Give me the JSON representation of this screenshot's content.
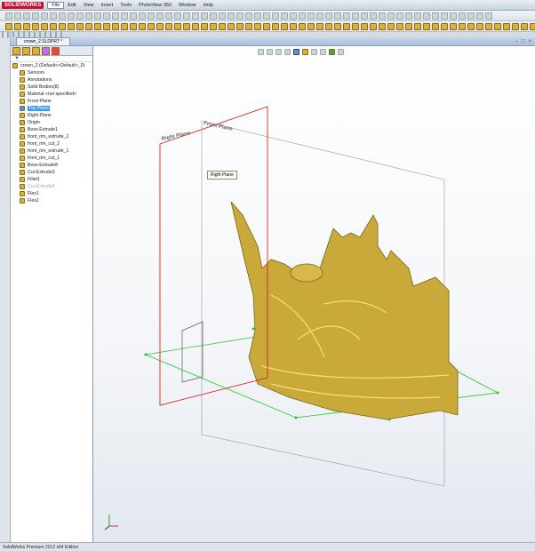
{
  "app": {
    "logo": "SOLIDWORKS",
    "menus": [
      "File",
      "Edit",
      "View",
      "Insert",
      "Tools",
      "PhotoView 360",
      "Window",
      "Help"
    ]
  },
  "document": {
    "tab": "crown_2.SLDPRT *"
  },
  "tree": {
    "root": "crown_2 (Default<<Default>_Di",
    "items": [
      {
        "label": "Sensors",
        "state": "normal"
      },
      {
        "label": "Annotations",
        "state": "normal"
      },
      {
        "label": "Solid Bodies(8)",
        "state": "normal"
      },
      {
        "label": "Material <not specified>",
        "state": "normal"
      },
      {
        "label": "Front Plane",
        "state": "normal"
      },
      {
        "label": "Top Plane",
        "state": "selected"
      },
      {
        "label": "Right Plane",
        "state": "normal"
      },
      {
        "label": "Origin",
        "state": "normal"
      },
      {
        "label": "Boss-Extrude1",
        "state": "normal"
      },
      {
        "label": "front_rim_extrude_2",
        "state": "normal"
      },
      {
        "label": "front_rim_cut_2",
        "state": "normal"
      },
      {
        "label": "front_rim_extrude_1",
        "state": "normal"
      },
      {
        "label": "front_rim_cut_1",
        "state": "normal"
      },
      {
        "label": "Boss-Extrude8",
        "state": "normal"
      },
      {
        "label": "Cut-Extrude3",
        "state": "normal"
      },
      {
        "label": "Fillet1",
        "state": "normal"
      },
      {
        "label": "Cut-Extrude4",
        "state": "suppressed"
      },
      {
        "label": "Flex1",
        "state": "normal"
      },
      {
        "label": "Flex2",
        "state": "normal"
      }
    ]
  },
  "viewport": {
    "plane_labels": {
      "right": "Right Plane",
      "front": "Front Plane"
    },
    "tooltip": "Right Plane",
    "model_color": "#c9a93a",
    "plane_color": "#e02020",
    "top_plane_color": "#22cc22"
  },
  "status": {
    "text": "SolidWorks Premium 2012 x64 Edition"
  }
}
